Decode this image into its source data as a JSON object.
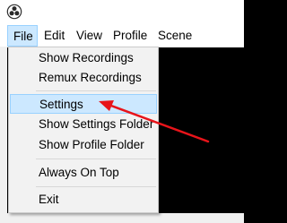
{
  "menubar": {
    "items": [
      {
        "label": "File"
      },
      {
        "label": "Edit"
      },
      {
        "label": "View"
      },
      {
        "label": "Profile"
      },
      {
        "label": "Scene Collection"
      }
    ]
  },
  "file_menu": {
    "items": [
      {
        "label": "Show Recordings"
      },
      {
        "label": "Remux Recordings"
      },
      {
        "label": "Settings"
      },
      {
        "label": "Show Settings Folder"
      },
      {
        "label": "Show Profile Folder"
      },
      {
        "label": "Always On Top"
      },
      {
        "label": "Exit"
      }
    ],
    "highlighted": "Settings"
  },
  "annotation": {
    "color": "#e8141a"
  },
  "icons": {
    "app": "obs-logo-icon"
  }
}
